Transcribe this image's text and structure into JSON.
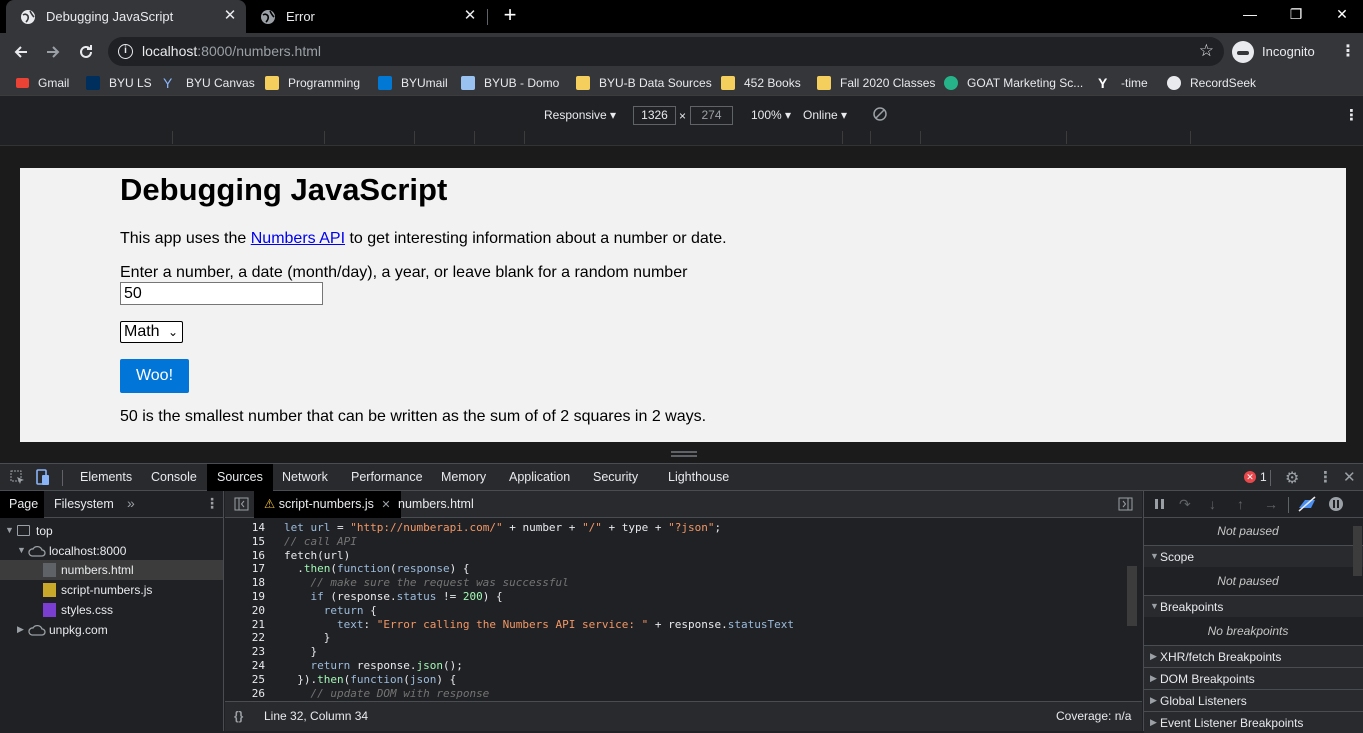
{
  "tabs": [
    {
      "title": "Debugging JavaScript",
      "active": true
    },
    {
      "title": "Error",
      "active": false
    }
  ],
  "window_controls": {
    "minimize": "—",
    "restore": "❐",
    "close": "✕"
  },
  "toolbar": {
    "url_host": "localhost",
    "url_rest": ":8000/numbers.html",
    "incognito_label": "Incognito"
  },
  "bookmarks": [
    {
      "label": "Gmail",
      "icon": "gmail-icon",
      "color": "#ea4335"
    },
    {
      "label": "BYU LS",
      "icon": "byu-ls-icon",
      "color": "#002e5d"
    },
    {
      "label": "BYU Canvas",
      "icon": "canvas-icon",
      "color": "#8ab4f8"
    },
    {
      "label": "Programming",
      "icon": "folder-icon",
      "color": "#f4cf5e"
    },
    {
      "label": "BYUmail",
      "icon": "outlook-icon",
      "color": "#0078d4"
    },
    {
      "label": "BYUB - Domo",
      "icon": "domo-icon",
      "color": "#99c2f0"
    },
    {
      "label": "BYU-B Data Sources",
      "icon": "folder-icon",
      "color": "#f4cf5e"
    },
    {
      "label": "452 Books",
      "icon": "folder-icon",
      "color": "#f4cf5e"
    },
    {
      "label": "Fall 2020 Classes",
      "icon": "folder-icon",
      "color": "#f4cf5e"
    },
    {
      "label": "GOAT Marketing Sc...",
      "icon": "goat-icon",
      "color": "#26b38a"
    },
    {
      "label": "-time",
      "icon": "y-icon",
      "color": "#ffffff"
    },
    {
      "label": "RecordSeek",
      "icon": "recordseek-icon",
      "color": "#e8eaed"
    }
  ],
  "device_toolbar": {
    "mode": "Responsive",
    "width": "1326",
    "times": "×",
    "height": "274",
    "zoom": "100%",
    "throttle": "Online"
  },
  "page": {
    "heading": "Debugging JavaScript",
    "intro_before": "This app uses the ",
    "intro_link": "Numbers API",
    "intro_after": " to get interesting information about a number or date.",
    "input_label": "Enter a number, a date (month/day), a year, or leave blank for a random number",
    "input_value": "50",
    "select_value": "Math",
    "button_label": "Woo!",
    "result": "50 is the smallest number that can be written as the sum of of 2 squares in 2 ways."
  },
  "devtools": {
    "tabs": [
      "Elements",
      "Console",
      "Sources",
      "Network",
      "Performance",
      "Memory",
      "Application",
      "Security",
      "Lighthouse"
    ],
    "active_tab": "Sources",
    "error_count": "1",
    "navigator_tabs": [
      "Page",
      "Filesystem"
    ],
    "more": "»",
    "tree": [
      {
        "label": "top",
        "level": 0,
        "type": "frame",
        "expanded": true
      },
      {
        "label": "localhost:8000",
        "level": 1,
        "type": "cloud",
        "expanded": true
      },
      {
        "label": "numbers.html",
        "level": 2,
        "type": "html",
        "selected": true
      },
      {
        "label": "script-numbers.js",
        "level": 2,
        "type": "js"
      },
      {
        "label": "styles.css",
        "level": 2,
        "type": "css"
      },
      {
        "label": "unpkg.com",
        "level": 1,
        "type": "cloud",
        "expanded": false
      }
    ],
    "editor_tabs": [
      {
        "label": "script-numbers.js",
        "warning": true,
        "active": true
      },
      {
        "label": "numbers.html",
        "warning": false,
        "active": false
      }
    ],
    "code_lines": [
      {
        "n": "14",
        "html": "<span class=\"k\">let</span> <span class=\"k\">url</span> = <span class=\"s\">\"http://numberapi.com/\"</span> + number + <span class=\"s\">\"/\"</span> + type + <span class=\"s\">\"?json\"</span>;",
        "indent": 0
      },
      {
        "n": "15",
        "html": "<span class=\"c\">// call API</span>",
        "indent": 0
      },
      {
        "n": "16",
        "html": "fetch(url)",
        "indent": 0
      },
      {
        "n": "17",
        "html": "  .<span class=\"n\">then</span>(<span class=\"k\">function</span>(<span class=\"k\">response</span>) {",
        "indent": 0
      },
      {
        "n": "18",
        "html": "    <span class=\"c\">// make sure the request was successful</span>",
        "indent": 0
      },
      {
        "n": "19",
        "html": "    <span class=\"k\">if</span> (response.<span class=\"k\">status</span> != <span class=\"n\">200</span>) {",
        "indent": 0
      },
      {
        "n": "20",
        "html": "      <span class=\"k\">return</span> {",
        "indent": 0
      },
      {
        "n": "21",
        "html": "        <span class=\"k\">text</span>: <span class=\"s\">\"Error calling the Numbers API service: \"</span> + response.<span class=\"k\">statusText</span>",
        "indent": 0
      },
      {
        "n": "22",
        "html": "      }",
        "indent": 0
      },
      {
        "n": "23",
        "html": "    }",
        "indent": 0
      },
      {
        "n": "24",
        "html": "    <span class=\"k\">return</span> response.<span class=\"n\">json</span>();",
        "indent": 0
      },
      {
        "n": "25",
        "html": "  }).<span class=\"n\">then</span>(<span class=\"k\">function</span>(<span class=\"k\">json</span>) {",
        "indent": 0
      },
      {
        "n": "26",
        "html": "    <span class=\"c\">// update DOM with response</span>",
        "indent": 0
      }
    ],
    "status_position": "Line 32, Column 34",
    "status_coverage": "Coverage: n/a",
    "pretty_print": "{}",
    "debug": {
      "not_paused": "Not paused",
      "sections": [
        {
          "label": "Scope",
          "expanded": true,
          "message": "Not paused"
        },
        {
          "label": "Breakpoints",
          "expanded": true,
          "message": "No breakpoints"
        },
        {
          "label": "XHR/fetch Breakpoints",
          "expanded": false
        },
        {
          "label": "DOM Breakpoints",
          "expanded": false
        },
        {
          "label": "Global Listeners",
          "expanded": false
        },
        {
          "label": "Event Listener Breakpoints",
          "expanded": false
        }
      ]
    }
  },
  "colors": {
    "accent": "#0275d8",
    "link": "#0000ee",
    "error": "#e8484c"
  }
}
